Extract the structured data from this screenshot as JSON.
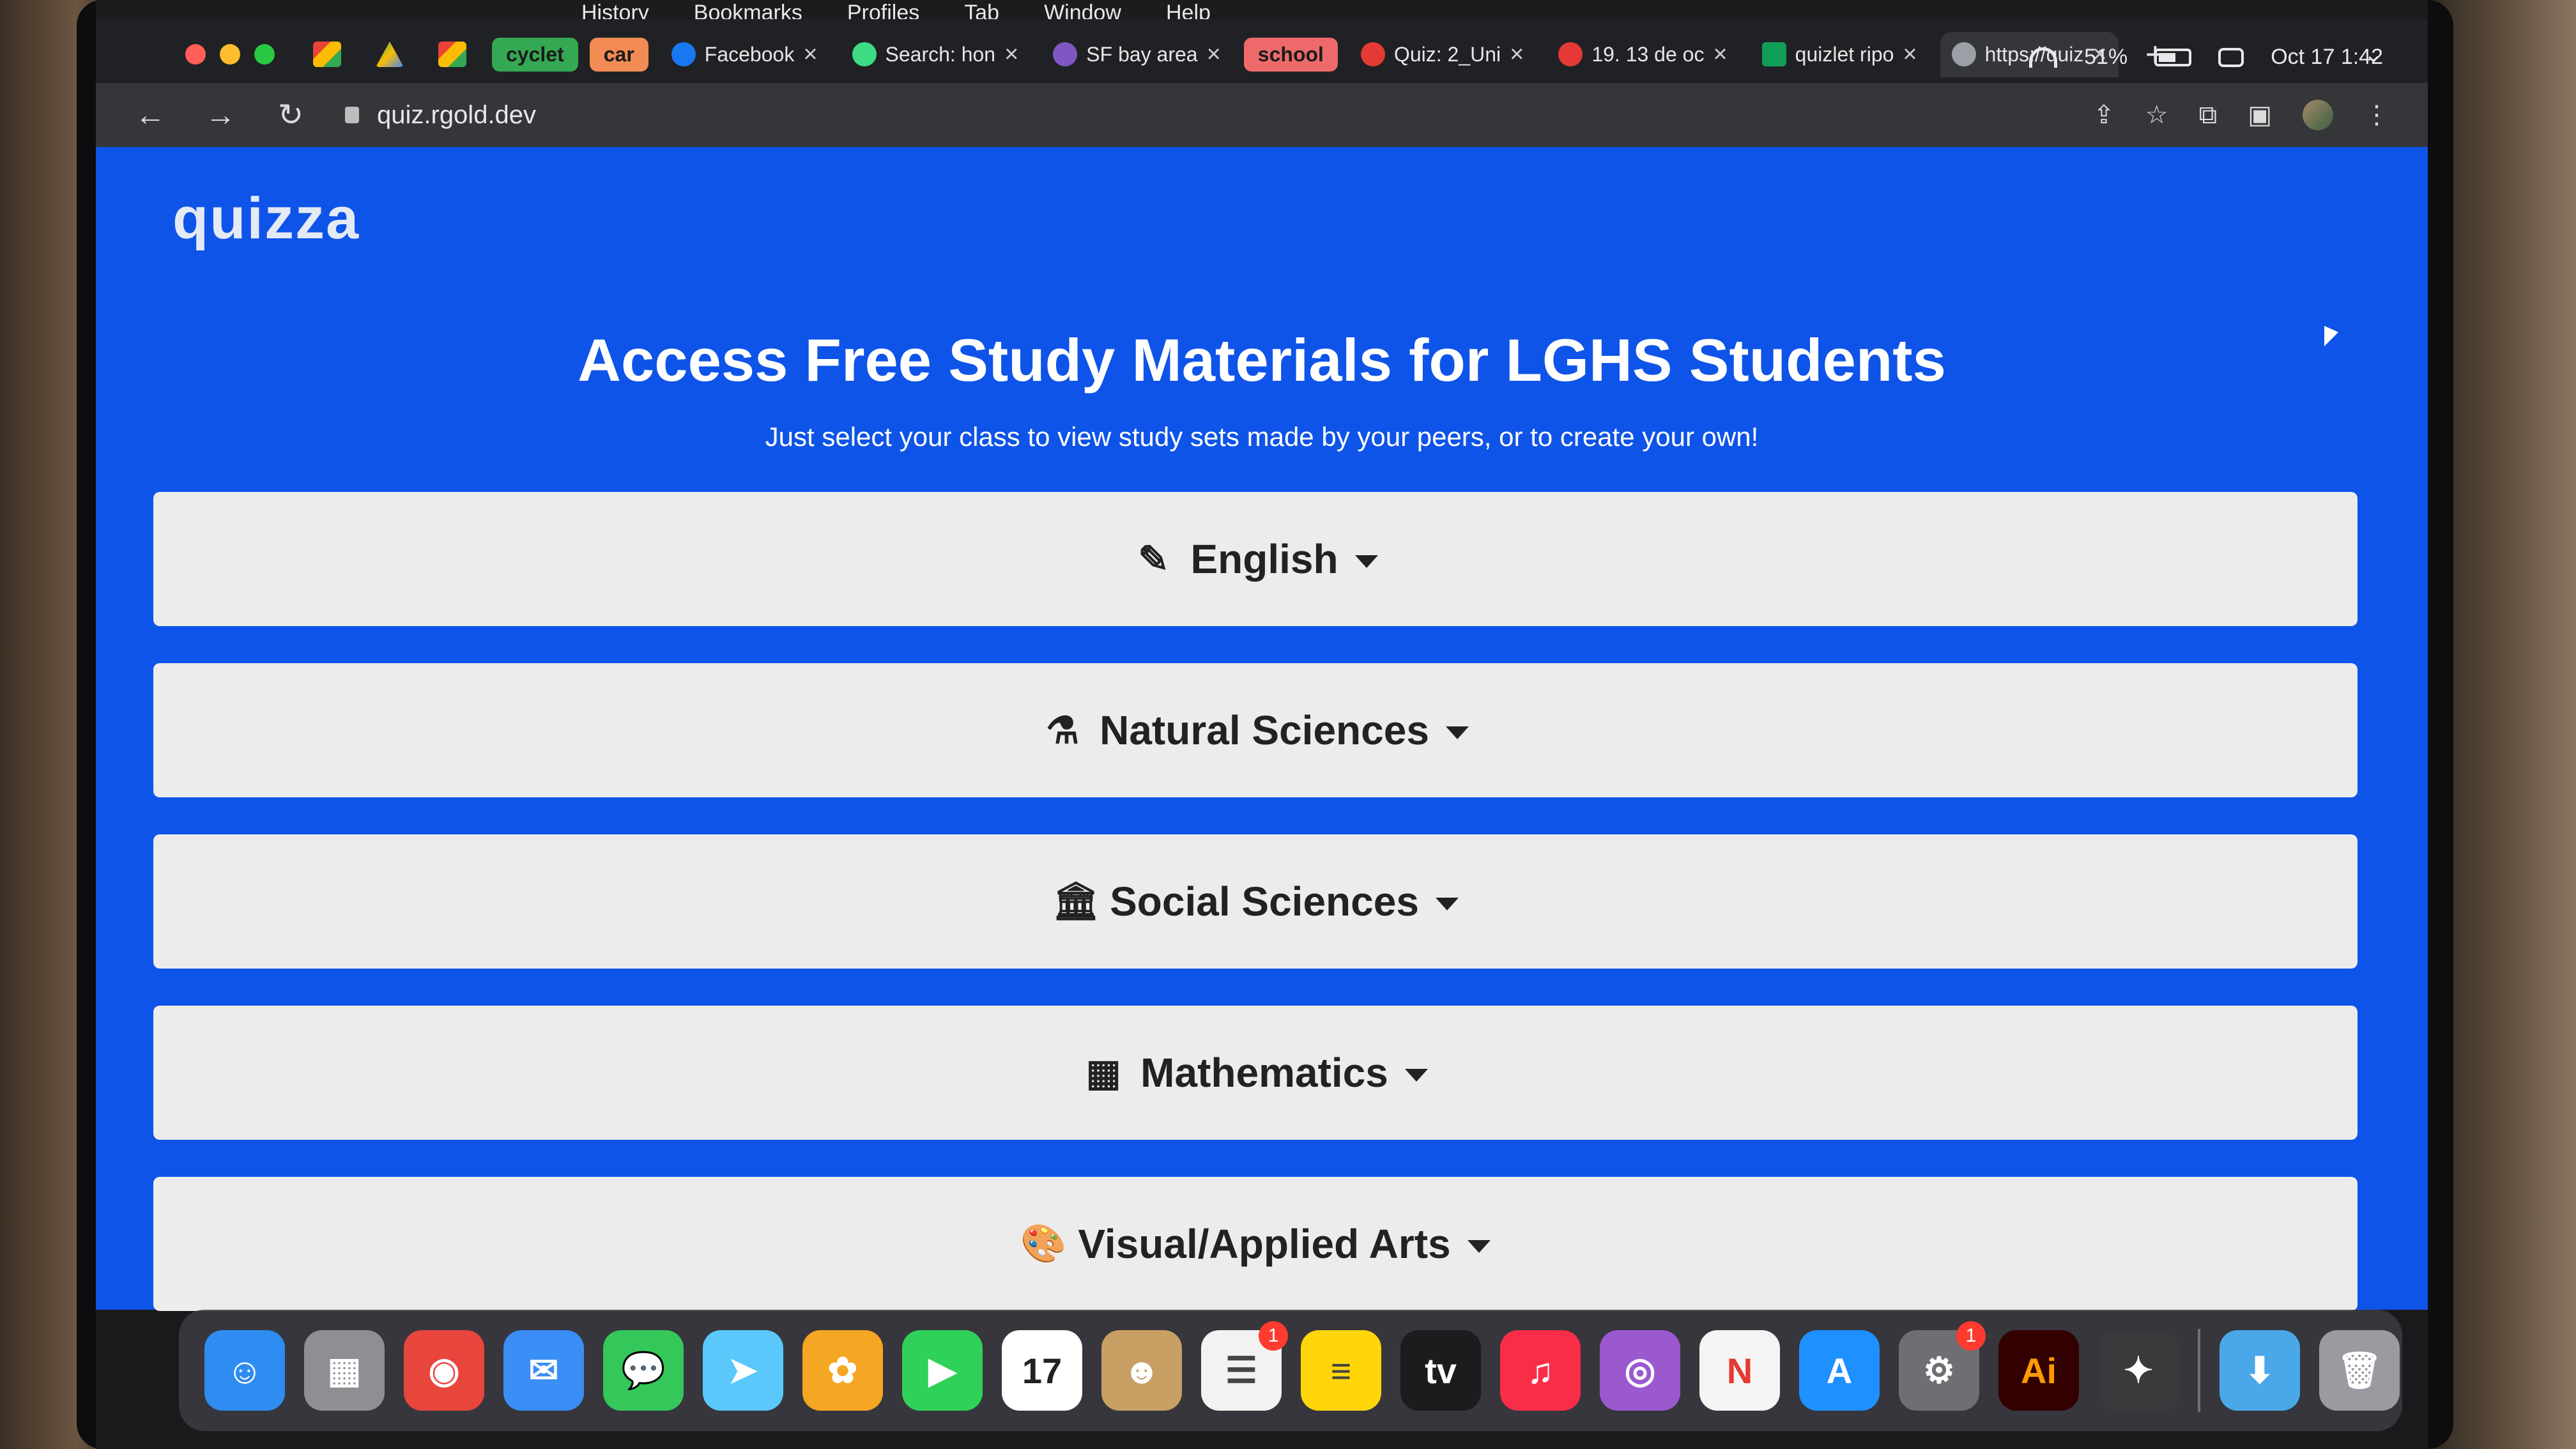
{
  "menubar": {
    "items": [
      "History",
      "Bookmarks",
      "Profiles",
      "Tab",
      "Window",
      "Help"
    ]
  },
  "status": {
    "battery": "51%",
    "datetime": "Oct 17  1:42"
  },
  "tabs": {
    "groups": [
      {
        "label": "cyclet",
        "color": "#34a853"
      },
      {
        "label": "car",
        "color": "#f28b54"
      },
      {
        "label": "school",
        "color": "#ee6a6a"
      }
    ],
    "items": [
      {
        "title": "Facebook",
        "favicon_color": "#1877f2"
      },
      {
        "title": "Search: hon",
        "favicon_color": "#3ddc84"
      },
      {
        "title": "SF bay area",
        "favicon_color": "#7e57c2"
      },
      {
        "title": "Quiz: 2_Uni",
        "favicon_color": "#e53935"
      },
      {
        "title": "19. 13 de oc",
        "favicon_color": "#e53935"
      },
      {
        "title": "quizlet ripo",
        "favicon_color": "#0f9d58"
      },
      {
        "title": "https://quiz",
        "favicon_color": "#9aa0a6"
      }
    ],
    "close_glyph": "×",
    "new_tab_glyph": "+",
    "menu_glyph": "⌄"
  },
  "toolbar": {
    "url": "quiz.rgold.dev",
    "back_glyph": "←",
    "forward_glyph": "→",
    "reload_glyph": "↻",
    "share_glyph": "⇪",
    "star_glyph": "☆",
    "extensions_glyph": "⧉",
    "sidepanel_glyph": "▣",
    "more_glyph": "⋮"
  },
  "page": {
    "logo": "quizza",
    "headline": "Access Free Study Materials for LGHS Students",
    "subhead": "Just select your class to view study sets made by your peers, or to create your own!",
    "classes": [
      {
        "label": "English",
        "icon": "pencil-icon",
        "glyph": "✎"
      },
      {
        "label": "Natural Sciences",
        "icon": "microscope-icon",
        "glyph": "⚗"
      },
      {
        "label": "Social Sciences",
        "icon": "landmark-icon",
        "glyph": "🏛"
      },
      {
        "label": "Mathematics",
        "icon": "calculator-icon",
        "glyph": "▦"
      },
      {
        "label": "Visual/Applied Arts",
        "icon": "palette-icon",
        "glyph": "🎨"
      }
    ]
  },
  "dock": {
    "apps": [
      {
        "name": "finder",
        "color": "#2f8cf0",
        "glyph": "☺"
      },
      {
        "name": "launchpad",
        "color": "#8e8e93",
        "glyph": "▦"
      },
      {
        "name": "chrome",
        "color": "#e8453c",
        "glyph": "◉"
      },
      {
        "name": "mail",
        "color": "#3a8ef6",
        "glyph": "✉"
      },
      {
        "name": "messages",
        "color": "#34c759",
        "glyph": "💬"
      },
      {
        "name": "maps",
        "color": "#5ac8fa",
        "glyph": "➤"
      },
      {
        "name": "photos",
        "color": "#f5a623",
        "glyph": "✿"
      },
      {
        "name": "facetime",
        "color": "#30d158",
        "glyph": "▶"
      },
      {
        "name": "calendar",
        "color": "#ffffff",
        "glyph": "17",
        "text_color": "#222"
      },
      {
        "name": "contacts",
        "color": "#c8a064",
        "glyph": "☻"
      },
      {
        "name": "reminders",
        "color": "#f2f2f2",
        "glyph": "☰",
        "badge": "1",
        "text_color": "#444"
      },
      {
        "name": "notes",
        "color": "#ffd60a",
        "glyph": "≡",
        "text_color": "#444"
      },
      {
        "name": "apple-tv",
        "color": "#1c1c1e",
        "glyph": "tv"
      },
      {
        "name": "music",
        "color": "#fa2d48",
        "glyph": "♫"
      },
      {
        "name": "podcasts",
        "color": "#9b59d0",
        "glyph": "◎"
      },
      {
        "name": "news",
        "color": "#f4f4f4",
        "glyph": "N",
        "text_color": "#e53935"
      },
      {
        "name": "app-store",
        "color": "#1e90ff",
        "glyph": "A"
      },
      {
        "name": "system-settings",
        "color": "#6e6e73",
        "glyph": "⚙",
        "badge": "1"
      },
      {
        "name": "illustrator",
        "color": "#330000",
        "glyph": "Ai",
        "text_color": "#ff9a00"
      },
      {
        "name": "script-editor",
        "color": "#3a3a3c",
        "glyph": "✦"
      }
    ],
    "folders": [
      {
        "name": "downloads",
        "color": "#4aa8e8",
        "glyph": "⬇"
      },
      {
        "name": "trash",
        "color": "#9a9aa0",
        "glyph": "🗑"
      }
    ]
  }
}
